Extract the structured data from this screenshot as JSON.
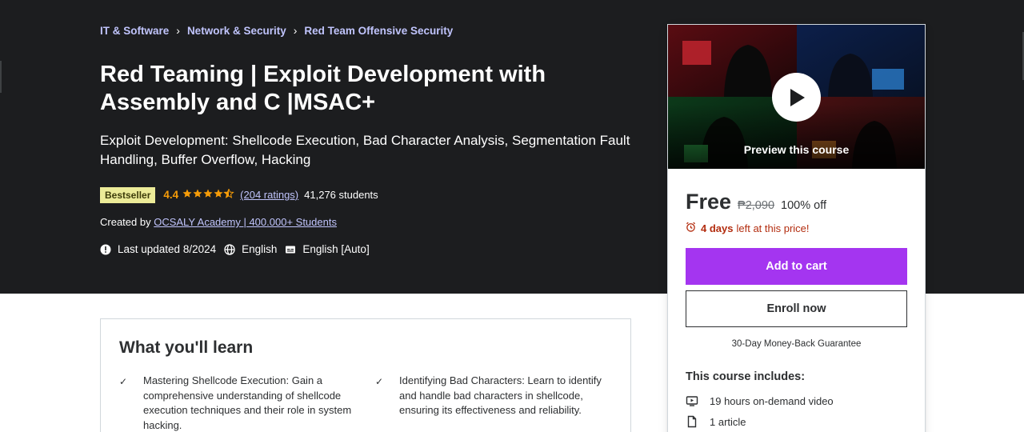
{
  "breadcrumb": {
    "items": [
      "IT & Software",
      "Network & Security",
      "Red Team Offensive Security"
    ],
    "separator_icon": "chevron-right-icon"
  },
  "course": {
    "title": "Red Teaming | Exploit Development with Assembly and C |MSAC+",
    "subtitle": "Exploit Development: Shellcode Execution, Bad Character Analysis, Segmentation Fault Handling, Buffer Overflow, Hacking",
    "badge": "Bestseller",
    "rating": "4.4",
    "rating_stars": 4.4,
    "ratings_count": "(204 ratings)",
    "students": "41,276 students",
    "created_by_label": "Created by",
    "instructor": "OCSALY Academy | 400.000+ Students",
    "last_updated": "Last updated 8/2024",
    "language": "English",
    "captions": "English [Auto]"
  },
  "learn": {
    "title": "What you'll learn",
    "items": [
      "Mastering Shellcode Execution: Gain a comprehensive understanding of shellcode execution techniques and their role in system hacking.",
      "Identifying Bad Characters: Learn to identify and handle bad characters in shellcode, ensuring its effectiveness and reliability."
    ]
  },
  "sidebar": {
    "preview_label": "Preview this course",
    "price": "Free",
    "original_price": "₱2,090",
    "discount": "100% off",
    "timer_days": "4 days",
    "timer_rest": "left at this price!",
    "add_to_cart": "Add to cart",
    "enroll_now": "Enroll now",
    "guarantee": "30-Day Money-Back Guarantee",
    "includes_title": "This course includes:",
    "includes": [
      "19 hours on-demand video",
      "1 article"
    ]
  },
  "colors": {
    "hero_bg": "#1c1d1f",
    "link": "#c0c4fc",
    "accent_purple": "#a435f0",
    "star": "#f69c08",
    "badge_bg": "#eceb98",
    "timer_red": "#b32d0f"
  }
}
